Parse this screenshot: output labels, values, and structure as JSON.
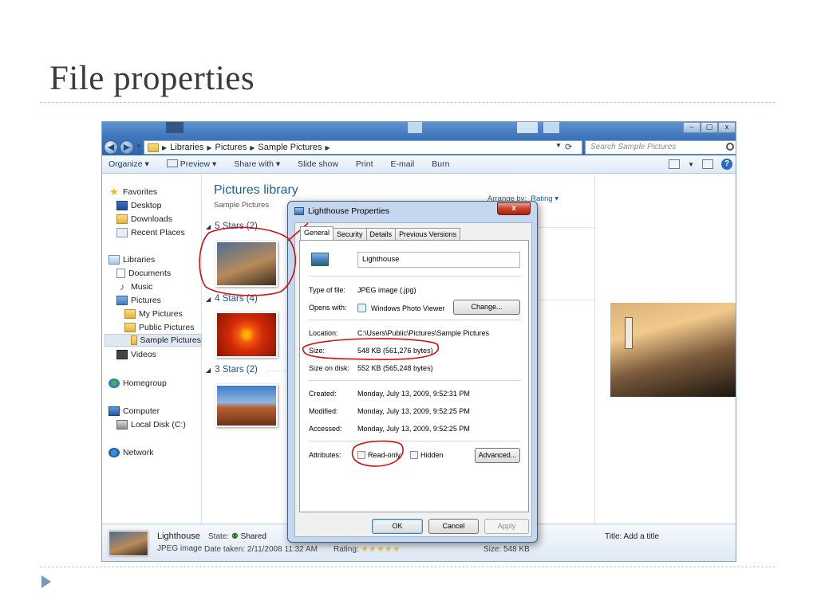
{
  "slide": {
    "title": "File properties"
  },
  "explorer": {
    "window_buttons": [
      "–",
      "▢",
      "x"
    ],
    "address": {
      "crumbs": [
        "Libraries",
        "Pictures",
        "Sample Pictures"
      ],
      "search_placeholder": "Search Sample Pictures"
    },
    "toolbar": {
      "organize": "Organize ▾",
      "preview": "Preview ▾",
      "share_with": "Share with ▾",
      "slide_show": "Slide show",
      "print": "Print",
      "email": "E-mail",
      "burn": "Burn",
      "help": "?"
    },
    "nav": {
      "favorites": "Favorites",
      "desktop": "Desktop",
      "downloads": "Downloads",
      "recent_places": "Recent Places",
      "libraries": "Libraries",
      "documents": "Documents",
      "music": "Music",
      "pictures": "Pictures",
      "my_pictures": "My Pictures",
      "public_pictures": "Public Pictures",
      "sample_pictures": "Sample Pictures",
      "videos": "Videos",
      "homegroup": "Homegroup",
      "computer": "Computer",
      "local_disk": "Local Disk (C:)",
      "network": "Network"
    },
    "library": {
      "title": "Pictures library",
      "subtitle": "Sample Pictures",
      "arrange_label": "Arrange by:",
      "arrange_value": "Rating ▾",
      "groups": [
        "5 Stars (2)",
        "4 Stars (4)",
        "3 Stars (2)"
      ]
    },
    "details_bar": {
      "name": "Lighthouse",
      "type": "JPEG image",
      "state_label": "State:",
      "state_value": "Shared",
      "date_taken": "Date taken: 2/11/2008 11:32 AM",
      "rating_label": "Rating:",
      "rating_stars": "★★★★★",
      "size": "Size: 548 KB",
      "title": "Title: Add a title"
    }
  },
  "dialog": {
    "title": "Lighthouse Properties",
    "close": "x",
    "tabs": [
      "General",
      "Security",
      "Details",
      "Previous Versions"
    ],
    "file_name": "Lighthouse",
    "type_label": "Type of file:",
    "type_value": "JPEG image (.jpg)",
    "opens_label": "Opens with:",
    "opens_value": "Windows Photo Viewer",
    "change_button": "Change...",
    "location_label": "Location:",
    "location_value": "C:\\Users\\Public\\Pictures\\Sample Pictures",
    "size_label": "Size:",
    "size_value": "548 KB (561,276 bytes)",
    "size_on_disk_label": "Size on disk:",
    "size_on_disk_value": "552 KB (565,248 bytes)",
    "created_label": "Created:",
    "created_value": "Monday, July 13, 2009, 9:52:31 PM",
    "modified_label": "Modified:",
    "modified_value": "Monday, July 13, 2009, 9:52:25 PM",
    "accessed_label": "Accessed:",
    "accessed_value": "Monday, July 13, 2009, 9:52:25 PM",
    "attributes_label": "Attributes:",
    "readonly_label": "Read-only",
    "hidden_label": "Hidden",
    "advanced_button": "Advanced...",
    "ok_button": "OK",
    "cancel_button": "Cancel",
    "apply_button": "Apply"
  },
  "colors": {
    "annotation": "#d01010",
    "link_blue": "#1f5f9e",
    "title_gray": "#3b3b3b"
  }
}
